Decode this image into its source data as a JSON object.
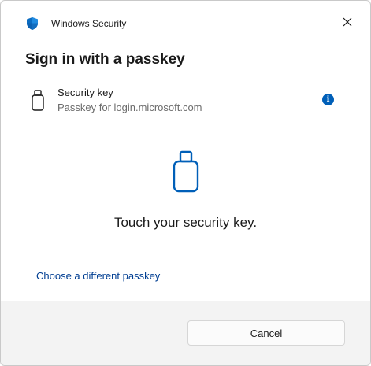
{
  "window": {
    "title": "Windows Security",
    "app_icon": "shield-icon",
    "close_icon": "close-icon"
  },
  "heading": "Sign in with a passkey",
  "passkey": {
    "icon": "usb-key-icon",
    "title": "Security key",
    "subtitle": "Passkey for login.microsoft.com",
    "info_icon": "info-icon"
  },
  "prompt": {
    "icon": "usb-key-icon",
    "text": "Touch your security key."
  },
  "alt_link": "Choose a different passkey",
  "footer": {
    "cancel_label": "Cancel"
  },
  "colors": {
    "accent": "#005fb8",
    "link": "#003e92",
    "footer_bg": "#f3f3f3"
  }
}
